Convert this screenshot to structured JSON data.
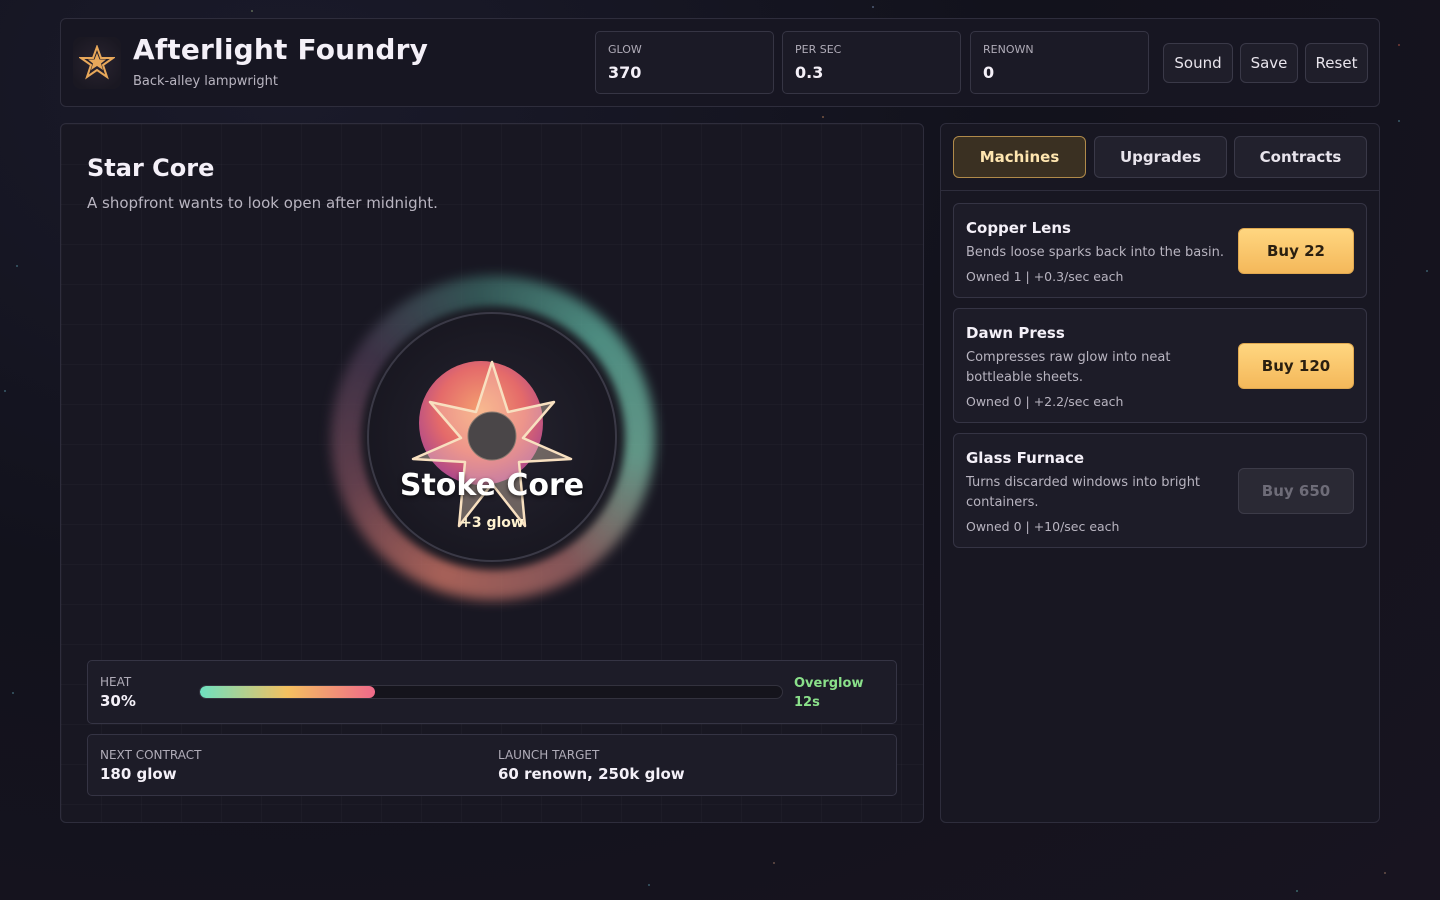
{
  "header": {
    "title": "Afterlight Foundry",
    "subtitle": "Back-alley lampwright",
    "logo_icon": "star-emblem-icon",
    "stats": [
      {
        "label": "GLOW",
        "value": "370"
      },
      {
        "label": "PER SEC",
        "value": "0.3"
      },
      {
        "label": "RENOWN",
        "value": "0"
      }
    ],
    "buttons": {
      "sound": "Sound",
      "save": "Save",
      "reset": "Reset"
    }
  },
  "core": {
    "title": "Star Core",
    "description": "A shopfront wants to look open after midnight.",
    "button_label": "Stoke Core",
    "gain_label": "+3 glow",
    "heat": {
      "label": "HEAT",
      "value": "30%",
      "fraction": 0.3
    },
    "overglow": {
      "label": "Overglow",
      "time": "12s"
    },
    "next_contract": {
      "label": "NEXT CONTRACT",
      "value": "180 glow"
    },
    "launch_target": {
      "label": "LAUNCH TARGET",
      "value": "60 renown, 250k glow"
    }
  },
  "shop": {
    "tabs": [
      "Machines",
      "Upgrades",
      "Contracts"
    ],
    "active_tab": "Machines",
    "machines": [
      {
        "name": "Copper Lens",
        "description": "Bends loose sparks back into the basin.",
        "owned": "Owned 1 | +0.3/sec each",
        "buy_label": "Buy 22",
        "affordable": true
      },
      {
        "name": "Dawn Press",
        "description": "Compresses raw glow into neat bottleable sheets.",
        "owned": "Owned 0 | +2.2/sec each",
        "buy_label": "Buy 120",
        "affordable": true
      },
      {
        "name": "Glass Furnace",
        "description": "Turns discarded windows into bright containers.",
        "owned": "Owned 0 | +10/sec each",
        "buy_label": "Buy 650",
        "affordable": false
      }
    ]
  },
  "colors": {
    "accent": "#f4b85a",
    "overglow": "#8ae08a",
    "active_tab_border": "#b08a4a"
  }
}
